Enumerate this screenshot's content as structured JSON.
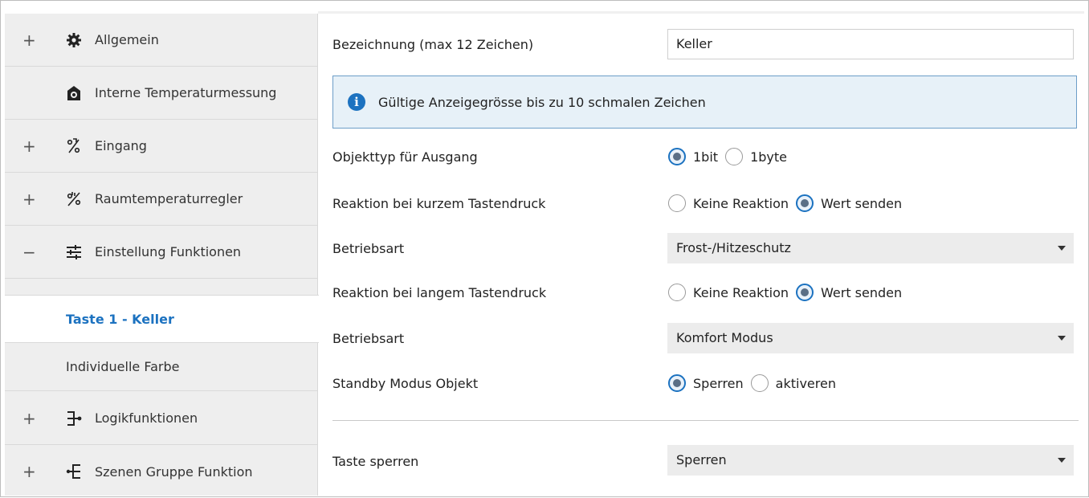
{
  "sidebar": {
    "items": [
      {
        "prefix": "+",
        "label": "Allgemein",
        "icon": "gear-icon"
      },
      {
        "prefix": "",
        "label": "Interne Temperaturmessung",
        "icon": "camera-house-icon"
      },
      {
        "prefix": "+",
        "label": "Eingang",
        "icon": "input-percent-icon"
      },
      {
        "prefix": "+",
        "label": "Raumtemperaturregler",
        "icon": "temperature-percent-icon"
      },
      {
        "prefix": "−",
        "label": "Einstellung Funktionen",
        "icon": "sliders-icon"
      },
      {
        "prefix": "+",
        "label": "Logikfunktionen",
        "icon": "logic-gate-icon"
      },
      {
        "prefix": "+",
        "label": "Szenen Gruppe Funktion",
        "icon": "scene-group-icon"
      }
    ],
    "subitems": [
      {
        "label": "Taste 1 - Keller",
        "active": true
      },
      {
        "label": "Individuelle Farbe",
        "active": false
      }
    ]
  },
  "form": {
    "bezeichnung": {
      "label": "Bezeichnung (max 12 Zeichen)",
      "value": "Keller"
    },
    "info": "Gültige Anzeigegrösse bis zu 10 schmalen Zeichen",
    "objekttyp": {
      "label": "Objekttyp für Ausgang",
      "options": [
        "1bit",
        "1byte"
      ],
      "selected": "1bit"
    },
    "kurz": {
      "label": "Reaktion bei kurzem Tastendruck",
      "options": [
        "Keine Reaktion",
        "Wert senden"
      ],
      "selected": "Wert senden"
    },
    "betriebsart1": {
      "label": "Betriebsart",
      "value": "Frost-/Hitzeschutz"
    },
    "lang": {
      "label": "Reaktion bei langem Tastendruck",
      "options": [
        "Keine Reaktion",
        "Wert senden"
      ],
      "selected": "Wert senden"
    },
    "betriebsart2": {
      "label": "Betriebsart",
      "value": "Komfort Modus"
    },
    "standby": {
      "label": "Standby Modus Objekt",
      "options": [
        "Sperren",
        "aktiveren"
      ],
      "selected": "Sperren"
    },
    "sperren": {
      "label": "Taste sperren",
      "value": "Sperren"
    }
  },
  "colors": {
    "accent": "#1c72c0",
    "sidebar_bg": "#eeeeee",
    "info_bg": "#e7f1f8",
    "select_bg": "#ececec"
  }
}
